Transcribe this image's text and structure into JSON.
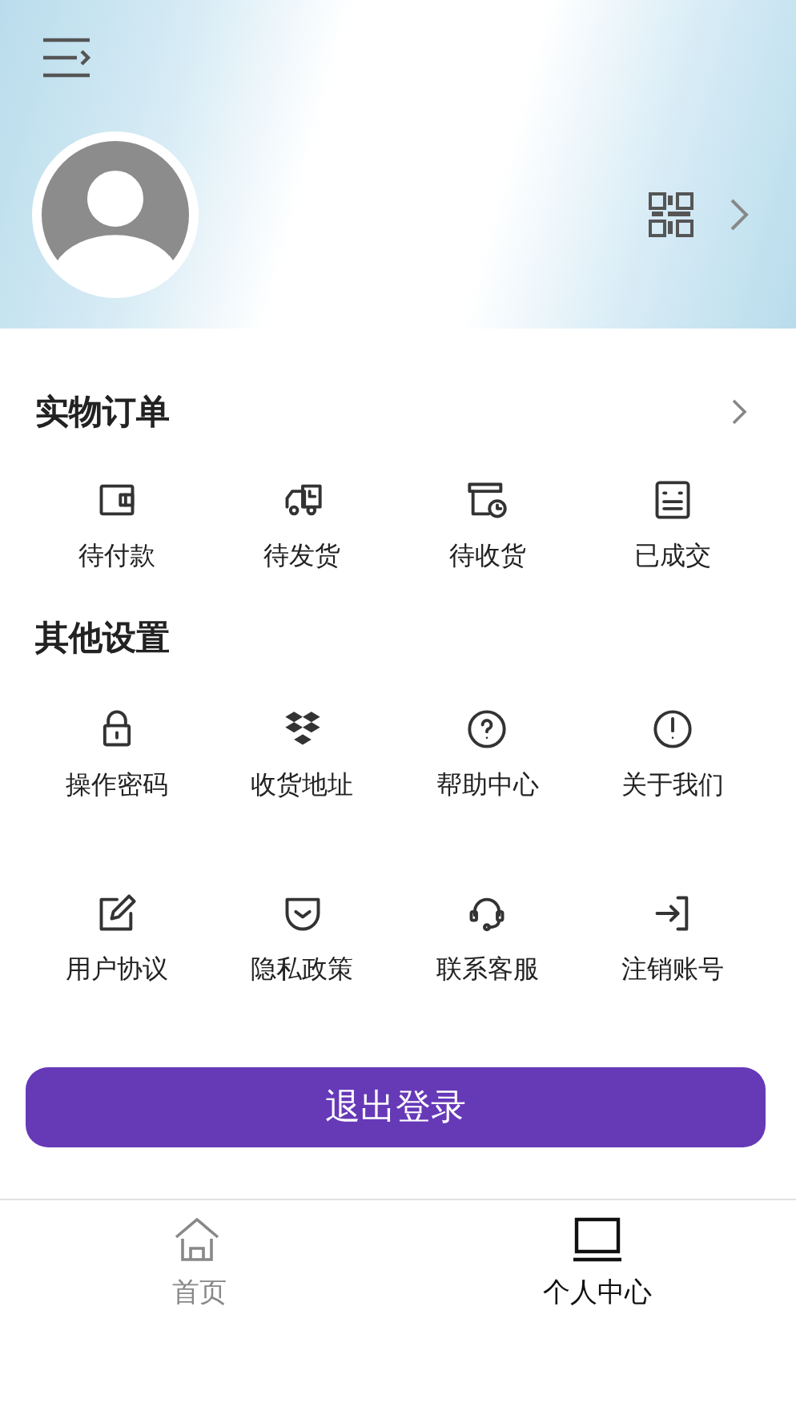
{
  "orders": {
    "title": "实物订单",
    "items": [
      {
        "label": "待付款"
      },
      {
        "label": "待发货"
      },
      {
        "label": "待收货"
      },
      {
        "label": "已成交"
      }
    ]
  },
  "settings": {
    "title": "其他设置",
    "items": [
      {
        "label": "操作密码"
      },
      {
        "label": "收货地址"
      },
      {
        "label": "帮助中心"
      },
      {
        "label": "关于我们"
      },
      {
        "label": "用户协议"
      },
      {
        "label": "隐私政策"
      },
      {
        "label": "联系客服"
      },
      {
        "label": "注销账号"
      }
    ]
  },
  "logout_button": "退出登录",
  "tabs": [
    {
      "label": "首页",
      "selected": false
    },
    {
      "label": "个人中心",
      "selected": true
    }
  ]
}
